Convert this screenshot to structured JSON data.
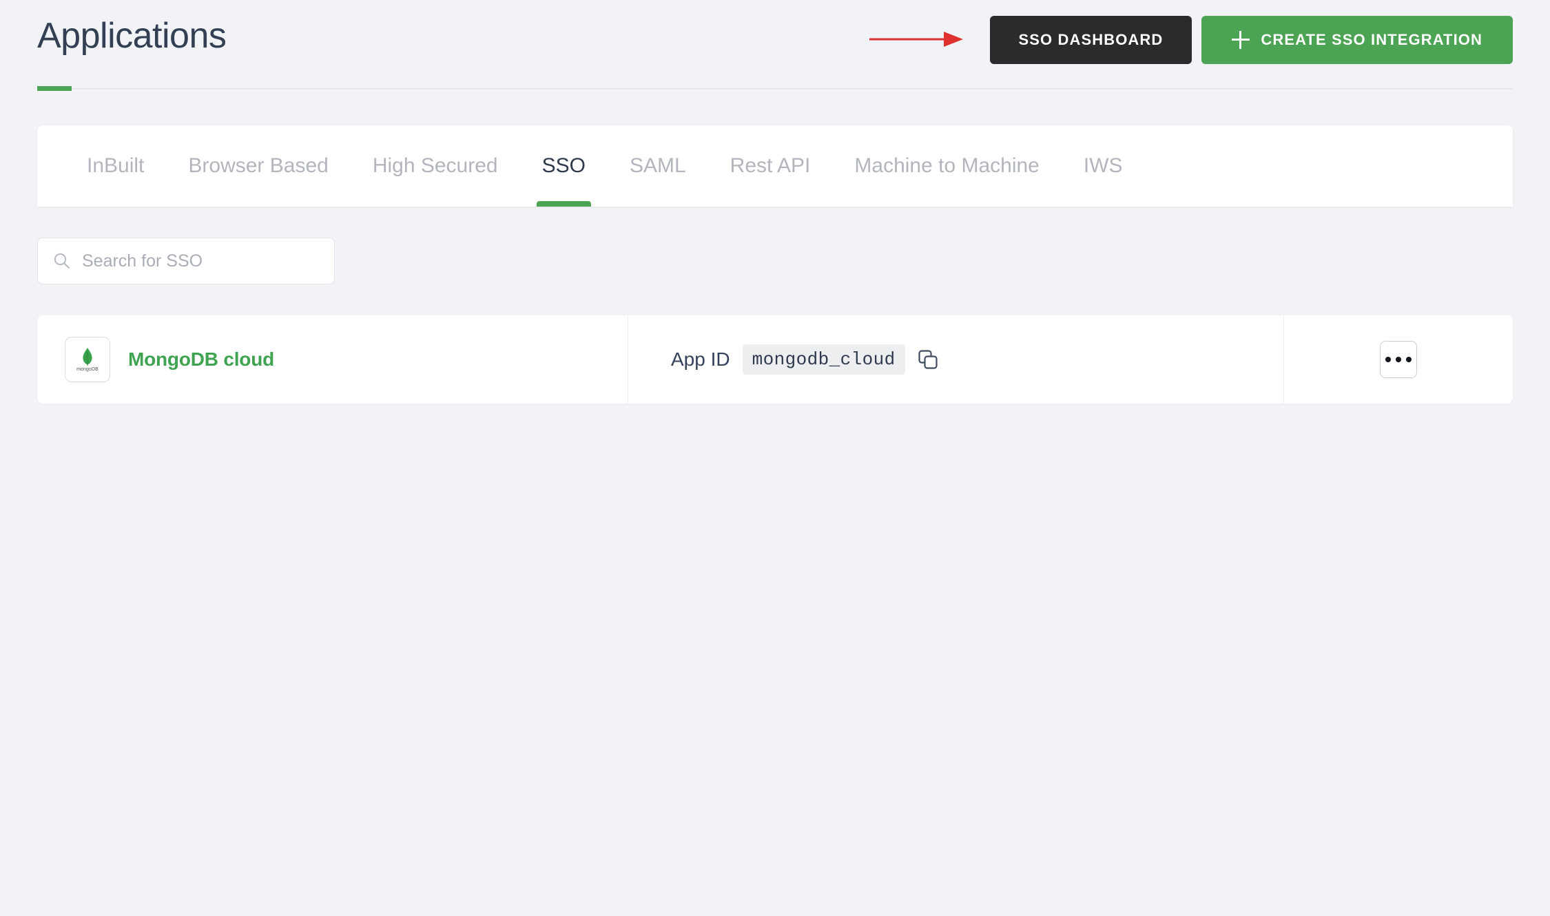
{
  "header": {
    "title": "Applications",
    "sso_dashboard_label": "SSO DASHBOARD",
    "create_integration_label": "CREATE SSO INTEGRATION",
    "accent_color": "#4ca353",
    "dark_button_color": "#2b2b2e",
    "annotation_arrow_color": "#e03131"
  },
  "tabs": {
    "items": [
      {
        "label": "InBuilt",
        "active": false
      },
      {
        "label": "Browser Based",
        "active": false
      },
      {
        "label": "High Secured",
        "active": false
      },
      {
        "label": "SSO",
        "active": true
      },
      {
        "label": "SAML",
        "active": false
      },
      {
        "label": "Rest API",
        "active": false
      },
      {
        "label": "Machine to Machine",
        "active": false
      },
      {
        "label": "IWS",
        "active": false
      }
    ],
    "active_label": "SSO"
  },
  "search": {
    "placeholder": "Search for SSO",
    "value": "",
    "icon": "search-icon"
  },
  "table": {
    "rows": [
      {
        "app_name": "MongoDB cloud",
        "logo_word": "mongoDB",
        "logo_icon": "mongodb-leaf-icon",
        "app_id_label": "App ID",
        "app_id_value": "mongodb_cloud",
        "copy_icon": "copy-icon",
        "menu_icon": "ellipsis-icon"
      }
    ]
  }
}
